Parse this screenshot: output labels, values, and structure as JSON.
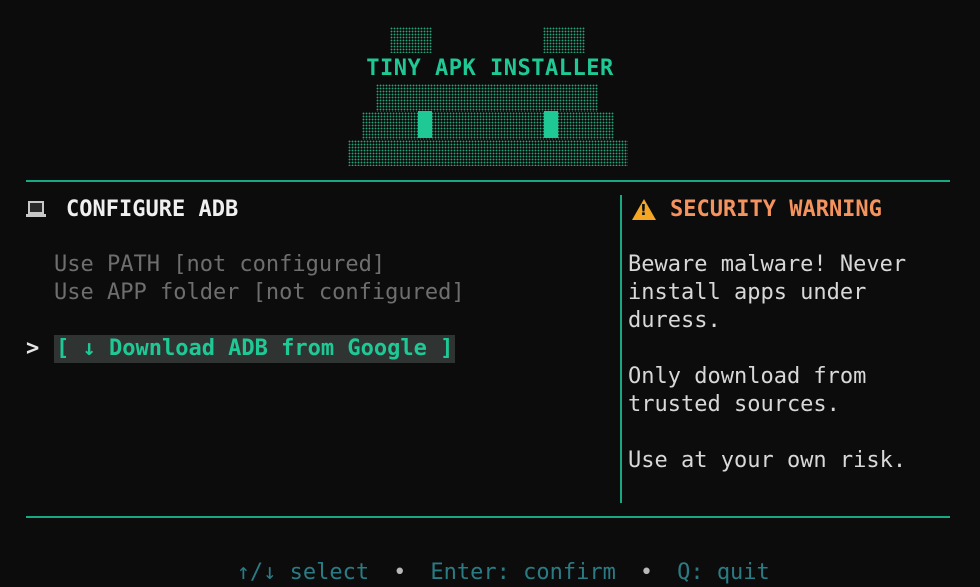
{
  "banner": {
    "title": "TINY APK INSTALLER",
    "accent_color": "#1fc995"
  },
  "left_panel": {
    "icon": "laptop-icon",
    "heading": "CONFIGURE ADB",
    "options": [
      "Use PATH [not configured]",
      "Use APP folder [not configured]"
    ],
    "cursor": ">",
    "selected_action": "[ ↓ Download ADB from Google ]"
  },
  "right_panel": {
    "icon": "warning-icon",
    "heading": "SECURITY WARNING",
    "heading_color": "#f5935f",
    "paragraphs": [
      "Beware malware! Never install apps under duress.",
      "Only download from trusted sources.",
      "Use at your own risk."
    ]
  },
  "footer": {
    "select_hint": "↑/↓ select",
    "separator": "•",
    "confirm_hint": "Enter: confirm",
    "quit_hint": "Q: quit"
  }
}
